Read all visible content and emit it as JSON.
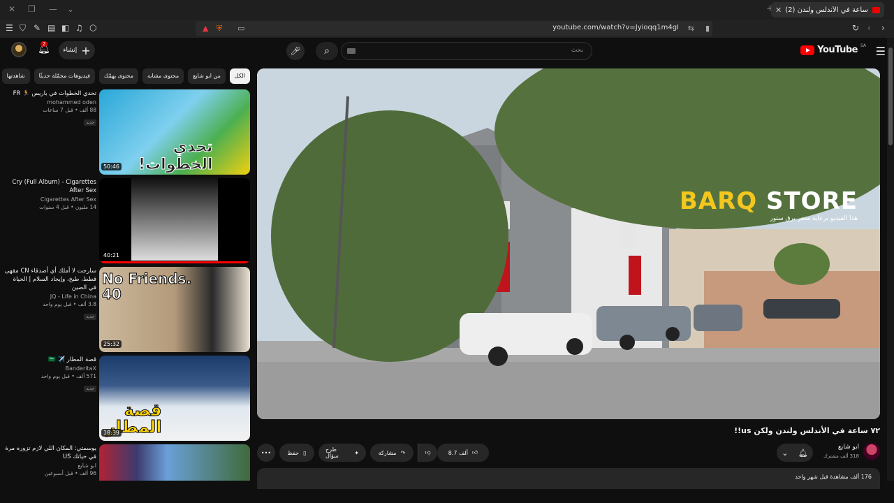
{
  "browser": {
    "tab_title": "(2) ٧٢ ساعة في الأندلس ولندن",
    "url": "youtube.com/watch?v=Jyioqq1m4gI"
  },
  "header": {
    "logo_text": "YouTube",
    "region": "SA",
    "search_placeholder": "بحث",
    "create_label": "إنشاء",
    "notification_count": "2"
  },
  "chips": [
    "الكل",
    "من ابو شايع",
    "محتوى مشابه",
    "محتوى يهمّك",
    "فيديوهات محمّلة حديثًا",
    "شاهدتها"
  ],
  "recommendations": [
    {
      "title": "تحدي الخطوات في باريس 🏃 FR",
      "channel": "mohammed oden",
      "views": "88 ألف • قبل 7 ساعات",
      "badge": "جديد",
      "duration": "50:46"
    },
    {
      "title": "Cry (Full Album) - Cigarettes After Sex",
      "channel": "Cigarettes After Sex",
      "views": "14 مليون • قبل 4 سنوات",
      "badge": "",
      "duration": "40:21"
    },
    {
      "title": "سارجت لا أملك أي أصدقاء CN مقهى قطط، طبخ، وإيجاد السلام | الحياة في الصين",
      "channel": "JQ - Life in China",
      "views": "3.8 ألف • قبل يوم واحد",
      "badge": "جديد",
      "duration": "25:32"
    },
    {
      "title": "قصة المطار ✈️ 🇸🇦",
      "channel": "BanderitaX",
      "views": "571 ألف • قبل يوم واحد",
      "badge": "جديد",
      "duration": "18:39"
    },
    {
      "title": "يوسمتي: المكان اللي لازم تزوره مرة في حياتك US",
      "channel": "ابو شايع",
      "views": "96 ألف • قبل أسبوعين",
      "badge": "",
      "duration": ""
    }
  ],
  "video": {
    "title": "٧٢ ساعة في الأندلس ولندن ولكن us!!",
    "channel": "ابو شايع",
    "subscribers": "318 ألف مشترك",
    "likes": "8.7 ألف",
    "share": "مشاركة",
    "ask": "طرح سؤال",
    "save": "حفظ",
    "views_line": "176 ألف مشاهدة  قبل شهر واحد",
    "overlay_brand": "BARQ",
    "overlay_brand_2": "STORE",
    "overlay_sub": "هذا الفيديو برعاية متجر برق ستور"
  }
}
